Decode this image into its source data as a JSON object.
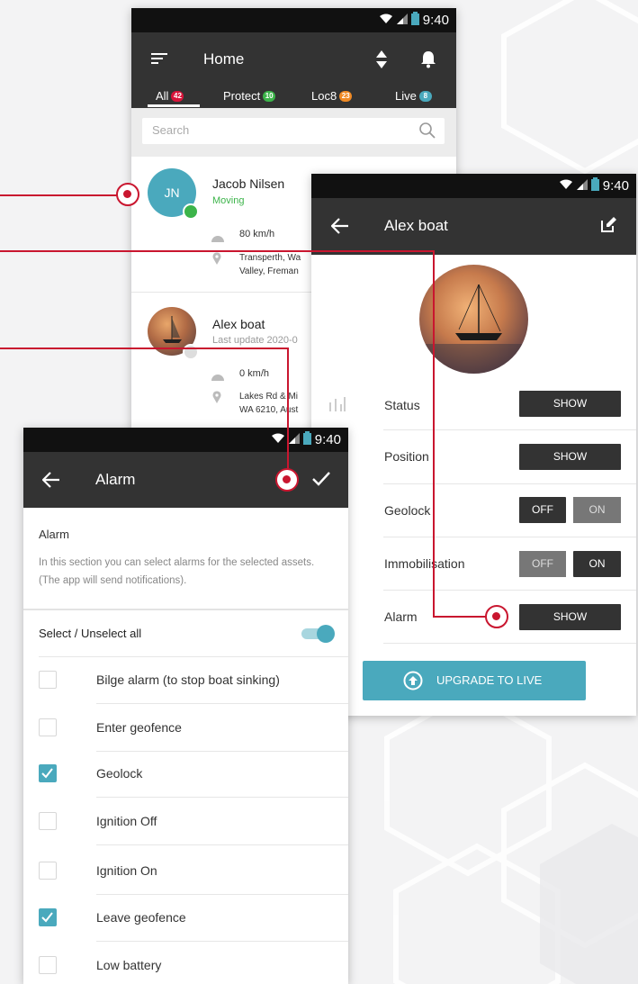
{
  "status_bar": {
    "time": "9:40"
  },
  "home": {
    "title": "Home",
    "tabs": [
      {
        "label": "All",
        "badge": "42",
        "badge_color": "#d8143a"
      },
      {
        "label": "Protect",
        "badge": "10",
        "badge_color": "#3cb44a"
      },
      {
        "label": "Loc8",
        "badge": "23",
        "badge_color": "#f08a24"
      },
      {
        "label": "Live",
        "badge": "8",
        "badge_color": "#4aa9bd"
      }
    ],
    "search_placeholder": "Search",
    "assets": [
      {
        "initials": "JN",
        "name": "Jacob Nilsen",
        "status": "Moving",
        "speed": "80 km/h",
        "address_line1": "Transperth, Wa",
        "address_line2": "Valley, Freman"
      },
      {
        "name": "Alex boat",
        "status": "Last update 2020-0",
        "speed": "0 km/h",
        "address_line1": "Lakes Rd & Mi",
        "address_line2": "WA 6210, Aust"
      }
    ]
  },
  "asset_detail": {
    "title": "Alex boat",
    "rows": [
      {
        "label": "Status",
        "button": "SHOW"
      },
      {
        "label": "Position",
        "button": "SHOW"
      },
      {
        "label": "Geolock",
        "off": "OFF",
        "on": "ON",
        "active": "off"
      },
      {
        "label": "Immobilisation",
        "off": "OFF",
        "on": "ON",
        "active": "on"
      },
      {
        "label": "Alarm",
        "button": "SHOW"
      }
    ],
    "upgrade_label": "UPGRADE TO LIVE"
  },
  "alarm": {
    "title": "Alarm",
    "section_heading": "Alarm",
    "description": "In this section you can select alarms for the selected assets. (The app will send notifications).",
    "select_all_label": "Select / Unselect all",
    "select_all_on": true,
    "items": [
      {
        "label": "Bilge alarm (to stop boat sinking)",
        "checked": false
      },
      {
        "label": "Enter geofence",
        "checked": false
      },
      {
        "label": "Geolock",
        "checked": true
      },
      {
        "label": "Ignition Off",
        "checked": false
      },
      {
        "label": "Ignition On",
        "checked": false
      },
      {
        "label": "Leave geofence",
        "checked": true
      },
      {
        "label": "Low battery",
        "checked": false
      }
    ]
  },
  "colors": {
    "accent": "#4aa9bd",
    "callout": "#c9162f",
    "appbar": "#333333",
    "online": "#3cb44a"
  }
}
